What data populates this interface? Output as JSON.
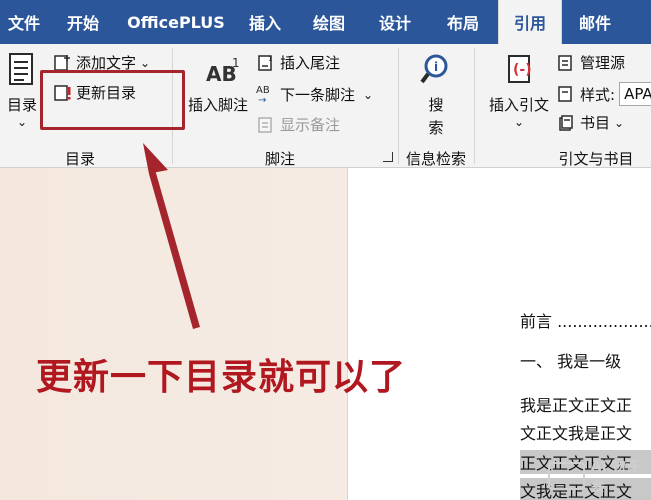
{
  "tabs": [
    {
      "label": "文件"
    },
    {
      "label": "开始"
    },
    {
      "label": "OfficePLUS"
    },
    {
      "label": "插入"
    },
    {
      "label": "绘图"
    },
    {
      "label": "设计"
    },
    {
      "label": "布局"
    },
    {
      "label": "引用",
      "active": true
    },
    {
      "label": "邮件"
    }
  ],
  "ribbon": {
    "toc_group": {
      "toc_button_label": "目录",
      "add_text_label": "添加文字",
      "update_toc_label": "更新目录",
      "group_label": "目录"
    },
    "footnote_group": {
      "insert_footnote_label": "插入脚注",
      "insert_endnote_label": "插入尾注",
      "next_footnote_label": "下一条脚注",
      "show_notes_label": "显示备注",
      "group_label": "脚注",
      "ab_glyph": "AB",
      "ab_superscript": "1"
    },
    "research_group": {
      "search_label_1": "搜",
      "search_label_2": "索",
      "group_label": "信息检索"
    },
    "citations_group": {
      "insert_citation_label": "插入引文",
      "manage_sources_label": "管理源",
      "style_label": "样式:",
      "style_value": "APA",
      "bibliography_label": "书目",
      "group_label": "引文与书目"
    }
  },
  "document": {
    "lines": [
      "前言 ..........................",
      "一、   我是一级",
      "我是正文正文正",
      "文正文我是正文",
      "正文正文正文正",
      "文我是正文正文"
    ]
  },
  "annotation": {
    "text": "更新一下目录就可以了",
    "color": "#b1171f"
  },
  "watermark": {
    "text": "AI 物许会"
  },
  "colors": {
    "ribbon_blue": "#2b579a",
    "ribbon_bg": "#f3f3f3",
    "annotation_red": "#a4262c"
  }
}
